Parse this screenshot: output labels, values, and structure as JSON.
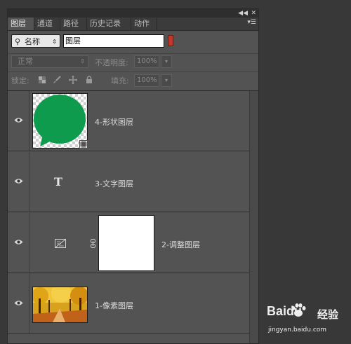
{
  "tabs": [
    {
      "label": "图层",
      "active": true
    },
    {
      "label": "通道",
      "active": false
    },
    {
      "label": "路径",
      "active": false
    },
    {
      "label": "历史记录",
      "active": false
    },
    {
      "label": "动作",
      "active": false
    }
  ],
  "filter": {
    "kind_label": "名称",
    "search_value": "图层"
  },
  "blend": {
    "mode": "正常",
    "opacity_label": "不透明度:",
    "opacity_value": "100%"
  },
  "lock": {
    "label": "锁定:",
    "fill_label": "填充:",
    "fill_value": "100%"
  },
  "layers": [
    {
      "name": "4-形状图层",
      "type": "shape",
      "fill_color": "#0f9b4e",
      "visible": true
    },
    {
      "name": "3-文字图层",
      "type": "text",
      "glyph": "T",
      "visible": true
    },
    {
      "name": "2-调整图层",
      "type": "adjustment",
      "visible": true
    },
    {
      "name": "1-像素图层",
      "type": "pixel",
      "visible": true
    }
  ],
  "watermark": {
    "brand": "Baidu",
    "suffix": "经验",
    "url": "jingyan.baidu.com"
  },
  "icons": {
    "search": "magnifier-icon",
    "menu": "panel-menu-icon",
    "eye": "eye-icon",
    "lock_transparent": "checker-lock-icon",
    "lock_image": "brush-lock-icon",
    "lock_position": "move-lock-icon",
    "lock_all": "padlock-icon",
    "adjust": "adjustment-icon",
    "chain": "link-icon"
  }
}
